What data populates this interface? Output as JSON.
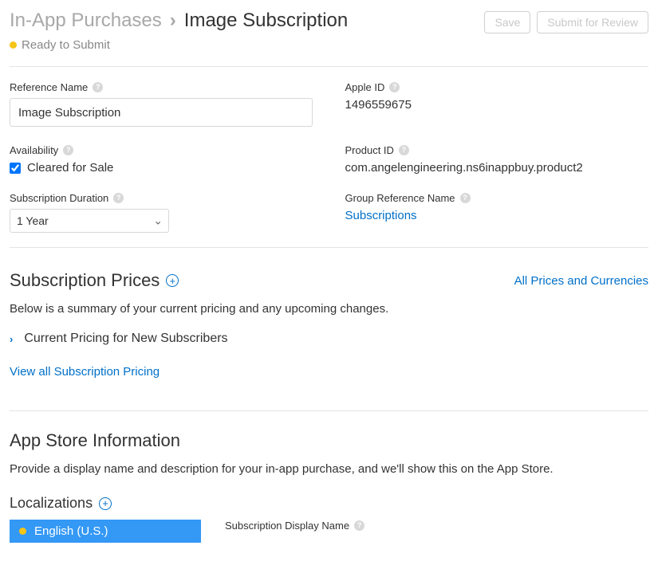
{
  "breadcrumb": {
    "parent": "In-App Purchases",
    "current": "Image Subscription"
  },
  "actions": {
    "save": "Save",
    "submit": "Submit for Review"
  },
  "status": "Ready to Submit",
  "fields": {
    "referenceName": {
      "label": "Reference Name",
      "value": "Image Subscription"
    },
    "appleId": {
      "label": "Apple ID",
      "value": "1496559675"
    },
    "availability": {
      "label": "Availability",
      "checkboxLabel": "Cleared for Sale"
    },
    "productId": {
      "label": "Product ID",
      "value": "com.angelengineering.ns6inappbuy.product2"
    },
    "duration": {
      "label": "Subscription Duration",
      "value": "1 Year"
    },
    "groupRef": {
      "label": "Group Reference Name",
      "link": "Subscriptions"
    }
  },
  "prices": {
    "title": "Subscription Prices",
    "allLink": "All Prices and Currencies",
    "summary": "Below is a summary of your current pricing and any upcoming changes.",
    "currentPricing": "Current Pricing for New Subscribers",
    "viewAll": "View all Subscription Pricing"
  },
  "appStore": {
    "title": "App Store Information",
    "desc": "Provide a display name and description for your in-app purchase, and we'll show this on the App Store."
  },
  "localizations": {
    "title": "Localizations",
    "lang": "English (U.S.)",
    "displayNameLabel": "Subscription Display Name"
  }
}
